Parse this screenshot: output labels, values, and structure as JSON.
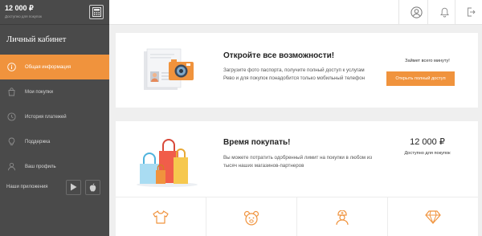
{
  "sidebar": {
    "balance": "12 000 ₽",
    "balance_caption": "Доступно для покупок",
    "title": "Личный кабинет",
    "items": [
      {
        "label": "Общая информация",
        "icon": "info-icon",
        "active": true
      },
      {
        "label": "Мои покупки",
        "icon": "bag-icon",
        "active": false
      },
      {
        "label": "История платежей",
        "icon": "history-icon",
        "active": false
      },
      {
        "label": "Поддержка",
        "icon": "lightbulb-icon",
        "active": false
      },
      {
        "label": "Ваш профиль",
        "icon": "user-icon",
        "active": false
      }
    ],
    "apps_label": "Наши приложения"
  },
  "topbar": {
    "icons": [
      "profile-icon",
      "bell-icon",
      "logout-icon"
    ]
  },
  "card_passport": {
    "title": "Откройте все возможности!",
    "text": "Загрузите фото паспорта, получите полный доступ к услугам Рево и для покупок понадобится только мобильный телефон",
    "time_label": "Займет всего минуту!",
    "button_label": "Открыть полный доступ"
  },
  "card_shopping": {
    "title": "Время покупать!",
    "text": "Вы можете потратить одобренный лимит на покупки в любом из тысяч наших магазинов-партнеров",
    "amount": "12 000 ₽",
    "amount_caption": "Доступно для покупок"
  },
  "categories": [
    "clothes-icon",
    "toys-icon",
    "medicine-icon",
    "jewelry-icon"
  ],
  "colors": {
    "accent": "#f0933d",
    "sidebar": "#4a4a4a"
  }
}
